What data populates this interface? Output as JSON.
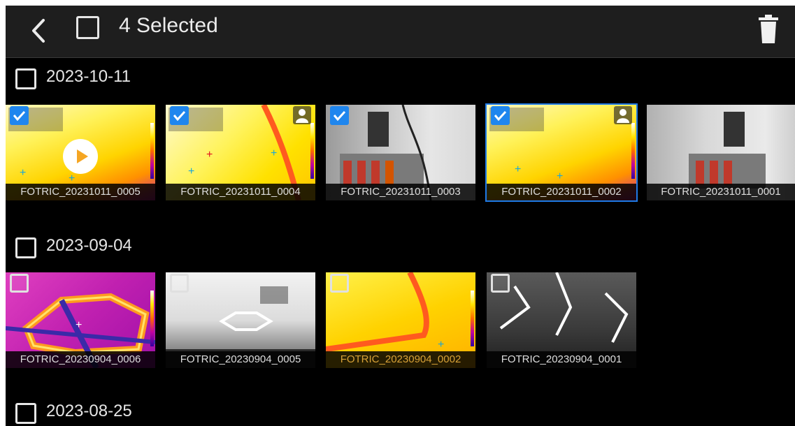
{
  "header": {
    "back_icon": "back-arrow-icon",
    "select_all_icon": "checkbox-icon",
    "title": "4 Selected",
    "delete_icon": "trash-icon"
  },
  "groups": [
    {
      "date": "2023-10-11",
      "items": [
        {
          "name": "FOTRIC_20231011_0005",
          "selected": true,
          "type": "thermal-video"
        },
        {
          "name": "FOTRIC_20231011_0004",
          "selected": true,
          "type": "thermal"
        },
        {
          "name": "FOTRIC_20231011_0003",
          "selected": true,
          "type": "visible"
        },
        {
          "name": "FOTRIC_20231011_0002",
          "selected": true,
          "type": "thermal"
        },
        {
          "name": "FOTRIC_20231011_0001",
          "selected": false,
          "type": "visible"
        }
      ]
    },
    {
      "date": "2023-09-04",
      "items": [
        {
          "name": "FOTRIC_20230904_0006",
          "selected": false,
          "type": "thermal"
        },
        {
          "name": "FOTRIC_20230904_0005",
          "selected": false,
          "type": "visible"
        },
        {
          "name": "FOTRIC_20230904_0002",
          "selected": false,
          "type": "thermal"
        },
        {
          "name": "FOTRIC_20230904_0001",
          "selected": false,
          "type": "visible"
        }
      ]
    },
    {
      "date": "2023-08-25",
      "items": []
    }
  ],
  "colors": {
    "selection_accent": "#1f86ee",
    "background": "#000000",
    "toolbar": "#1e1e1e",
    "caption_highlight": "#d8a238"
  }
}
